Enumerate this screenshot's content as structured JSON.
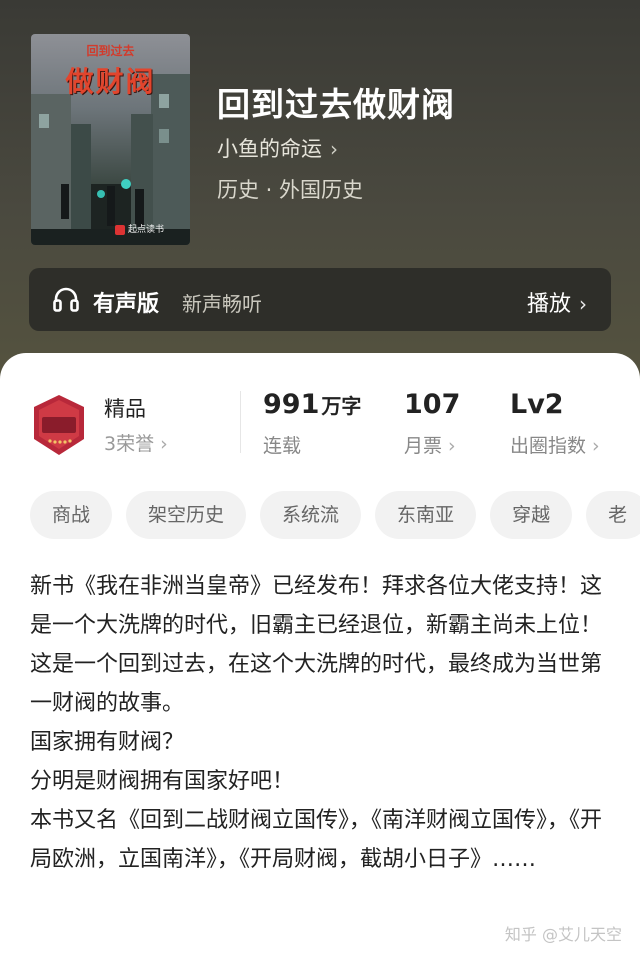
{
  "book": {
    "title": "回到过去做财阀",
    "author": "小鱼的命运",
    "author_chevron": "›",
    "genre": "历史 · 外国历史",
    "cover": {
      "top_text": "回到过去",
      "big_text": "做财阀",
      "publisher": "起点读书"
    }
  },
  "audio": {
    "icon": "headphones-icon",
    "label": "有声版",
    "sublabel": "新声畅听",
    "action": "播放",
    "action_chevron": "›"
  },
  "honor": {
    "badge_icon": "premium-channel-badge-icon",
    "title": "精品",
    "count": "3荣誉"
  },
  "stats": [
    {
      "value": "991",
      "unit": "万字",
      "label": "连载"
    },
    {
      "value": "107",
      "unit": "",
      "label": "月票"
    },
    {
      "value": "Lv2",
      "unit": "",
      "label": "出圈指数"
    }
  ],
  "tags": [
    "商战",
    "架空历史",
    "系统流",
    "东南亚",
    "穿越",
    "老"
  ],
  "description": [
    "新书《我在非洲当皇帝》已经发布！拜求各位大佬支持！这是一个大洗牌的时代，旧霸主已经退位，新霸主尚未上位！这是一个回到过去，在这个大洗牌的时代，最终成为当世第一财阀的故事。",
    "国家拥有财阀？",
    "分明是财阀拥有国家好吧！",
    "本书又名《回到二战财阀立国传》，《南洋财阀立国传》，《开局欧洲，立国南洋》，《开局财阀，截胡小日子》……"
  ],
  "watermark": "知乎 @艾儿天空",
  "colors": {
    "header_bg": "#45443b",
    "card_bg": "#ffffff",
    "badge_red": "#b8283a"
  }
}
